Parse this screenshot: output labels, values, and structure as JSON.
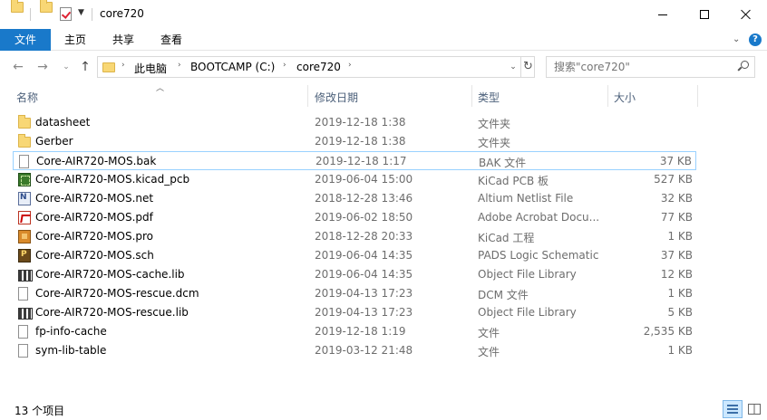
{
  "window": {
    "title": "core720"
  },
  "ribbon": {
    "tabs": [
      "文件",
      "主页",
      "共享",
      "查看"
    ]
  },
  "address": {
    "crumbs": [
      "此电脑",
      "BOOTCAMP (C:)",
      "core720"
    ],
    "search_placeholder": "搜索\"core720\""
  },
  "columns": {
    "name": "名称",
    "date": "修改日期",
    "type": "类型",
    "size": "大小"
  },
  "files": [
    {
      "name": "datasheet",
      "date": "2019-12-18 1:38",
      "type": "文件夹",
      "size": "",
      "icon": "folder-icon"
    },
    {
      "name": "Gerber",
      "date": "2019-12-18 1:38",
      "type": "文件夹",
      "size": "",
      "icon": "folder-icon"
    },
    {
      "name": "Core-AIR720-MOS.bak",
      "date": "2019-12-18 1:17",
      "type": "BAK 文件",
      "size": "37 KB",
      "icon": "document-icon"
    },
    {
      "name": "Core-AIR720-MOS.kicad_pcb",
      "date": "2019-06-04 15:00",
      "type": "KiCad PCB 板",
      "size": "527 KB",
      "icon": "kicad-pcb-icon"
    },
    {
      "name": "Core-AIR720-MOS.net",
      "date": "2018-12-28 13:46",
      "type": "Altium Netlist File",
      "size": "32 KB",
      "icon": "netlist-icon"
    },
    {
      "name": "Core-AIR720-MOS.pdf",
      "date": "2019-06-02 18:50",
      "type": "Adobe Acrobat Docu...",
      "size": "77 KB",
      "icon": "pdf-icon"
    },
    {
      "name": "Core-AIR720-MOS.pro",
      "date": "2018-12-28 20:33",
      "type": "KiCad 工程",
      "size": "1 KB",
      "icon": "kicad-project-icon"
    },
    {
      "name": "Core-AIR720-MOS.sch",
      "date": "2019-06-04 14:35",
      "type": "PADS Logic Schematic",
      "size": "37 KB",
      "icon": "pads-schematic-icon"
    },
    {
      "name": "Core-AIR720-MOS-cache.lib",
      "date": "2019-06-04 14:35",
      "type": "Object File Library",
      "size": "12 KB",
      "icon": "library-icon"
    },
    {
      "name": "Core-AIR720-MOS-rescue.dcm",
      "date": "2019-04-13 17:23",
      "type": "DCM 文件",
      "size": "1 KB",
      "icon": "document-icon"
    },
    {
      "name": "Core-AIR720-MOS-rescue.lib",
      "date": "2019-04-13 17:23",
      "type": "Object File Library",
      "size": "5 KB",
      "icon": "library-icon"
    },
    {
      "name": "fp-info-cache",
      "date": "2019-12-18 1:19",
      "type": "文件",
      "size": "2,535 KB",
      "icon": "document-icon"
    },
    {
      "name": "sym-lib-table",
      "date": "2019-03-12 21:48",
      "type": "文件",
      "size": "1 KB",
      "icon": "document-icon"
    }
  ],
  "selected_index": 2,
  "status": {
    "count_text": "13 个项目"
  },
  "colors": {
    "accent": "#1979ca",
    "header_text": "#4c607a",
    "selection_border": "#99d1ff"
  }
}
